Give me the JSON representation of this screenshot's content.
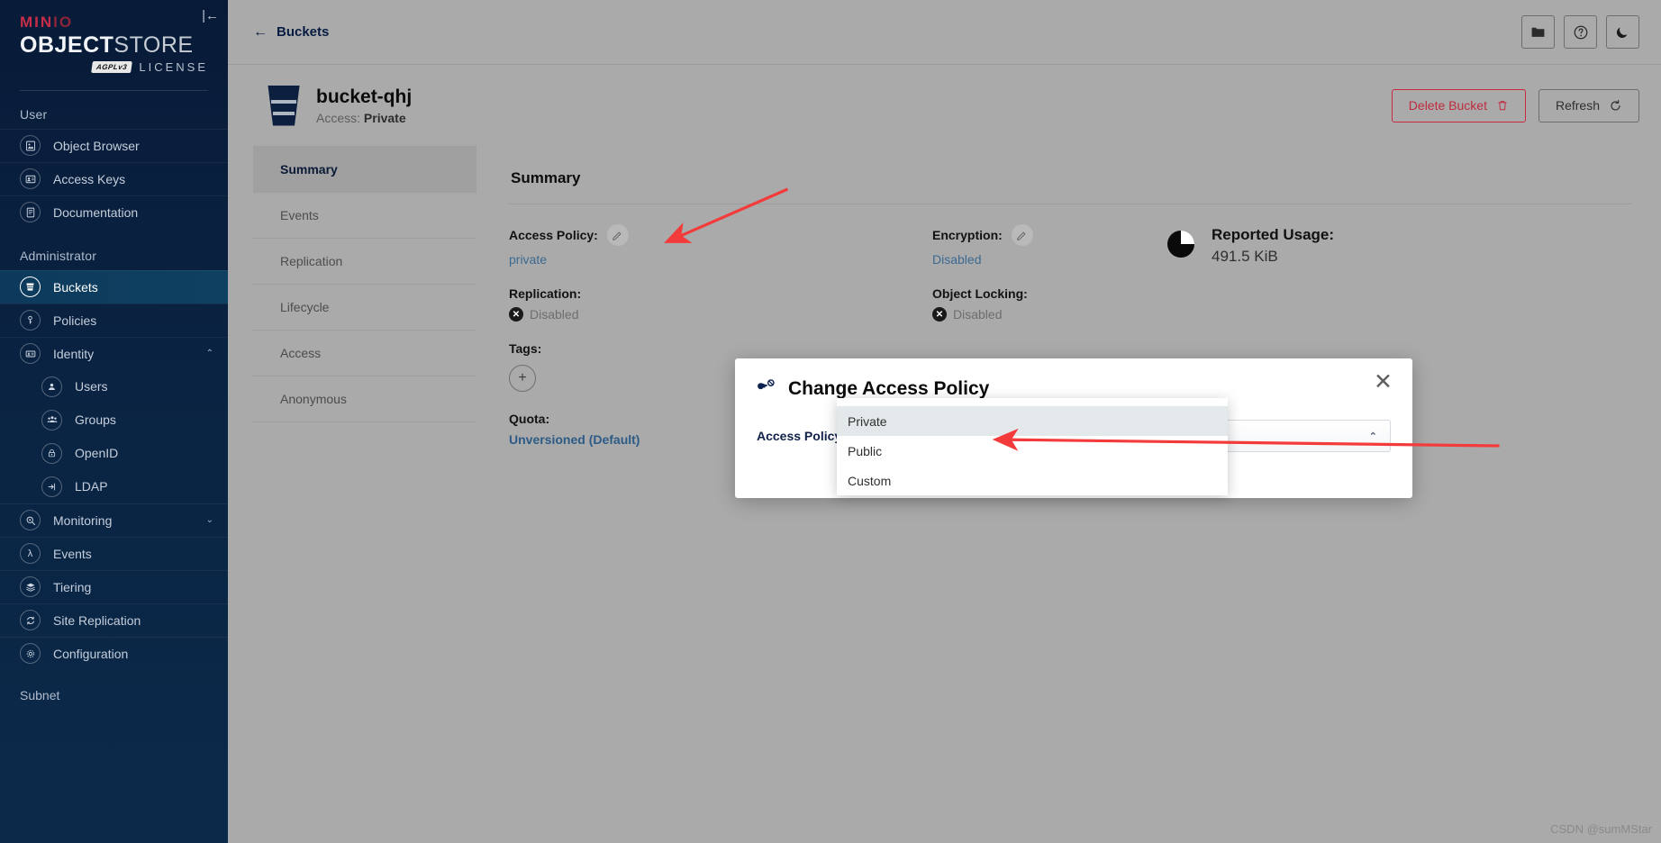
{
  "sidebar": {
    "logo": {
      "minio": "MIN",
      "minio_io": "IO",
      "object": "OBJECT",
      "store": "STORE",
      "agpl": "AGPLv3",
      "license": "LICENSE"
    },
    "collapse_icon": "collapse-left-icon",
    "sections": [
      {
        "title": "User",
        "items": [
          {
            "label": "Object Browser",
            "icon": "object-browser-icon",
            "active": false
          },
          {
            "label": "Access Keys",
            "icon": "access-keys-icon",
            "active": false
          },
          {
            "label": "Documentation",
            "icon": "documentation-icon",
            "active": false
          }
        ]
      },
      {
        "title": "Administrator",
        "items": [
          {
            "label": "Buckets",
            "icon": "buckets-icon",
            "active": true
          },
          {
            "label": "Policies",
            "icon": "policies-icon",
            "active": false
          },
          {
            "label": "Identity",
            "icon": "identity-icon",
            "active": false,
            "chevron": "chevron-up"
          },
          {
            "label": "Users",
            "icon": "user-icon",
            "child": true
          },
          {
            "label": "Groups",
            "icon": "groups-icon",
            "child": true
          },
          {
            "label": "OpenID",
            "icon": "openid-icon",
            "child": true
          },
          {
            "label": "LDAP",
            "icon": "ldap-icon",
            "child": true
          },
          {
            "label": "Monitoring",
            "icon": "monitoring-icon",
            "chevron": "chevron-down"
          },
          {
            "label": "Events",
            "icon": "events-lambda-icon"
          },
          {
            "label": "Tiering",
            "icon": "tiering-icon"
          },
          {
            "label": "Site Replication",
            "icon": "site-replication-icon"
          },
          {
            "label": "Configuration",
            "icon": "configuration-gear-icon"
          }
        ]
      }
    ],
    "subnet_title": "Subnet"
  },
  "topbar": {
    "breadcrumb": "Buckets",
    "back_arrow": "←",
    "actions": [
      {
        "name": "folder-icon"
      },
      {
        "name": "help-circle-icon"
      },
      {
        "name": "dark-mode-moon-icon"
      }
    ]
  },
  "bucket": {
    "name": "bucket-qhj",
    "access_prefix": "Access:",
    "access_value": "Private",
    "delete_label": "Delete Bucket",
    "refresh_label": "Refresh"
  },
  "tabs": [
    {
      "label": "Summary",
      "active": true
    },
    {
      "label": "Events",
      "active": false
    },
    {
      "label": "Replication",
      "active": false
    },
    {
      "label": "Lifecycle",
      "active": false
    },
    {
      "label": "Access",
      "active": false
    },
    {
      "label": "Anonymous",
      "active": false
    }
  ],
  "summary": {
    "title": "Summary",
    "access_policy_label": "Access Policy:",
    "access_policy_value": "private",
    "replication_label": "Replication:",
    "replication_value": "Disabled",
    "encryption_label": "Encryption:",
    "encryption_value": "Disabled",
    "object_locking_label": "Object Locking:",
    "object_locking_value": "Disabled",
    "tags_label": "Tags:",
    "tags_add": "+",
    "versioning_label": "Quota:",
    "versioning_value": "Unversioned (Default)",
    "reported_usage_label": "Reported Usage:",
    "reported_usage_value": "491.5 KiB"
  },
  "modal": {
    "icon": "key-icon",
    "title": "Change Access Policy",
    "close_icon": "close-icon",
    "field_label": "Access Policy",
    "selected_value": "Private",
    "caret": "chevron-up-icon",
    "options": [
      {
        "label": "Private",
        "selected": true
      },
      {
        "label": "Public",
        "selected": false
      },
      {
        "label": "Custom",
        "selected": false
      }
    ]
  },
  "annotations": {
    "arrow_color": "#f43b3b",
    "arrow1_target": "access-policy-edit-pencil",
    "arrow2_target": "dropdown-option-public"
  },
  "watermark": "CSDN @sumMStar"
}
